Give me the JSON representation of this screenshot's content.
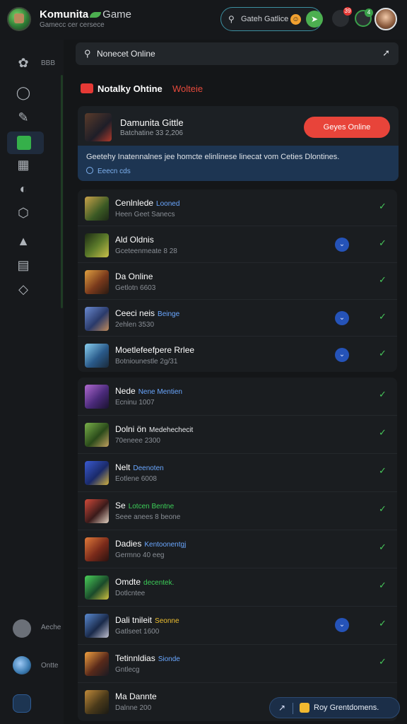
{
  "header": {
    "app_name": "Komunita",
    "app_name_suffix": "Game",
    "app_subtitle": "Gamecc cer cersece",
    "search_label": "Gateh Gatlice",
    "notif_badge": "39",
    "status_badge": "4"
  },
  "sidebar": {
    "top_label": "BBB",
    "bottom_items": [
      {
        "label": "Aeche"
      },
      {
        "label": "Ontte"
      }
    ]
  },
  "search": {
    "value": "Nonecet Online"
  },
  "section": {
    "title": "Notalky Ohtine",
    "accent": "Wolteie"
  },
  "featured": {
    "title": "Damunita Gittle",
    "subtitle": "Batchatine 33 2,206",
    "button_label": "Geyes Online",
    "description": "Geetehy Inatennalnes jee homcte elinlinese linecat vom Ceties Dlontines.",
    "link_label": "Eeecn cds"
  },
  "group1": [
    {
      "title": "Cenlnlede",
      "tag": "Looned",
      "tag_color": "#6aa7ff",
      "sub": "Heen Geet Sanecs"
    },
    {
      "title": "Ald Oldnis",
      "tag": "",
      "tag_color": "#ff6a4a",
      "sub": "Gceteenmeate 8 28"
    },
    {
      "title": "Da Online",
      "tag": "",
      "tag_color": "#3ccf58",
      "sub": "Getlotn 6603"
    },
    {
      "title": "Ceeci neis",
      "tag": "Beinge",
      "tag_color": "#6aa7ff",
      "sub": "2ehlen 3530"
    },
    {
      "title": "Moetlefeefpere Rrlee",
      "tag": "",
      "tag_color": "#6aa7ff",
      "sub": "Botniounestle 2g/31"
    }
  ],
  "group2": [
    {
      "title": "Nede",
      "tag": "Nene Mentien",
      "tag_color": "#6aa7ff",
      "sub": "Ecninu 1007"
    },
    {
      "title": "Dolni ön",
      "tag": "Medehechecit",
      "tag_color": "#e8eaed",
      "sub": "70eneee 2300"
    },
    {
      "title": "Nelt",
      "tag": "Deenoten",
      "tag_color": "#6aa7ff",
      "sub": "Eotlene 6008"
    },
    {
      "title": "Se",
      "tag": "Lotcen Bentne",
      "tag_color": "#3ccf58",
      "sub": "Seee anees 8 beone"
    },
    {
      "title": "Dadies",
      "tag": "Kentoonentgj",
      "tag_color": "#6aa7ff",
      "sub": "Germno 40 eeg"
    },
    {
      "title": "Omdte",
      "tag": "decentek.",
      "tag_color": "#3ccf58",
      "sub": "Dotlcntee"
    },
    {
      "title": "Dali tnileit",
      "tag": "Seonne",
      "tag_color": "#f0c030",
      "sub": "Gatlseet 1600"
    },
    {
      "title": "Tetinnldias",
      "tag": "Sionde",
      "tag_color": "#6aa7ff",
      "sub": "Gntlecg"
    },
    {
      "title": "Ma Dannte",
      "tag": "",
      "tag_color": "#e8eaed",
      "sub": "Dalnne 200"
    }
  ],
  "toast": {
    "label": "Roy Grentdomens."
  }
}
